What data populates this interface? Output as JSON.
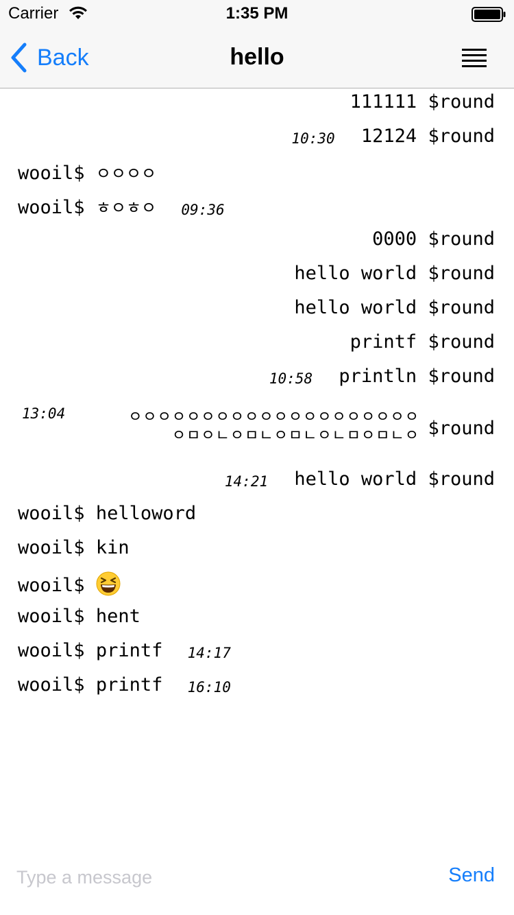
{
  "status": {
    "carrier": "Carrier",
    "time": "1:35 PM"
  },
  "nav": {
    "back_label": "Back",
    "title": "hello",
    "menu_icon": "hamburger-menu-icon"
  },
  "messages": [
    {
      "side": "right",
      "text": "111111",
      "sender": "$round",
      "time": ""
    },
    {
      "side": "right",
      "text": "12124",
      "sender": "$round",
      "time": "10:30"
    },
    {
      "side": "left",
      "sender": "wooil$",
      "text": "ㅇㅇㅇㅇ",
      "time": ""
    },
    {
      "side": "left",
      "sender": "wooil$",
      "text": "ㅎㅇㅎㅇ",
      "time": "09:36"
    },
    {
      "side": "right",
      "text": "0000",
      "sender": "$round",
      "time": ""
    },
    {
      "side": "right",
      "text": "hello world",
      "sender": "$round",
      "time": ""
    },
    {
      "side": "right",
      "text": "hello world",
      "sender": "$round",
      "time": ""
    },
    {
      "side": "right",
      "text": "printf",
      "sender": "$round",
      "time": ""
    },
    {
      "side": "right",
      "text": "println",
      "sender": "$round",
      "time": "10:58"
    },
    {
      "side": "right",
      "text_line1": "ㅇㅇㅇㅇㅇㅇㅇㅇㅇㅇㅇㅇㅇㅇㅇㅇㅇㅇㅇㅇ",
      "text_line2": "ㅇㅁㅇㄴㅇㅁㄴㅇㅁㄴㅇㄴㅁㅇㅁㄴㅇ",
      "sender": "$round",
      "time": "13:04"
    },
    {
      "side": "right",
      "text": "hello world",
      "sender": "$round",
      "time": "14:21"
    },
    {
      "side": "left",
      "sender": "wooil$",
      "text": "helloword",
      "time": ""
    },
    {
      "side": "left",
      "sender": "wooil$",
      "text": "kin",
      "time": ""
    },
    {
      "side": "left",
      "sender": "wooil$",
      "text": "",
      "emoji": "grinning-squinting-face-icon",
      "time": ""
    },
    {
      "side": "left",
      "sender": "wooil$",
      "text": "hent",
      "time": ""
    },
    {
      "side": "left",
      "sender": "wooil$",
      "text": "printf",
      "time": "14:17"
    },
    {
      "side": "left",
      "sender": "wooil$",
      "text": "printf",
      "time": "16:10"
    }
  ],
  "input": {
    "placeholder": "Type a message",
    "value": "",
    "send_label": "Send"
  },
  "colors": {
    "accent": "#157efb",
    "nav_background": "#f7f7f7",
    "placeholder": "#c7c7cd"
  }
}
